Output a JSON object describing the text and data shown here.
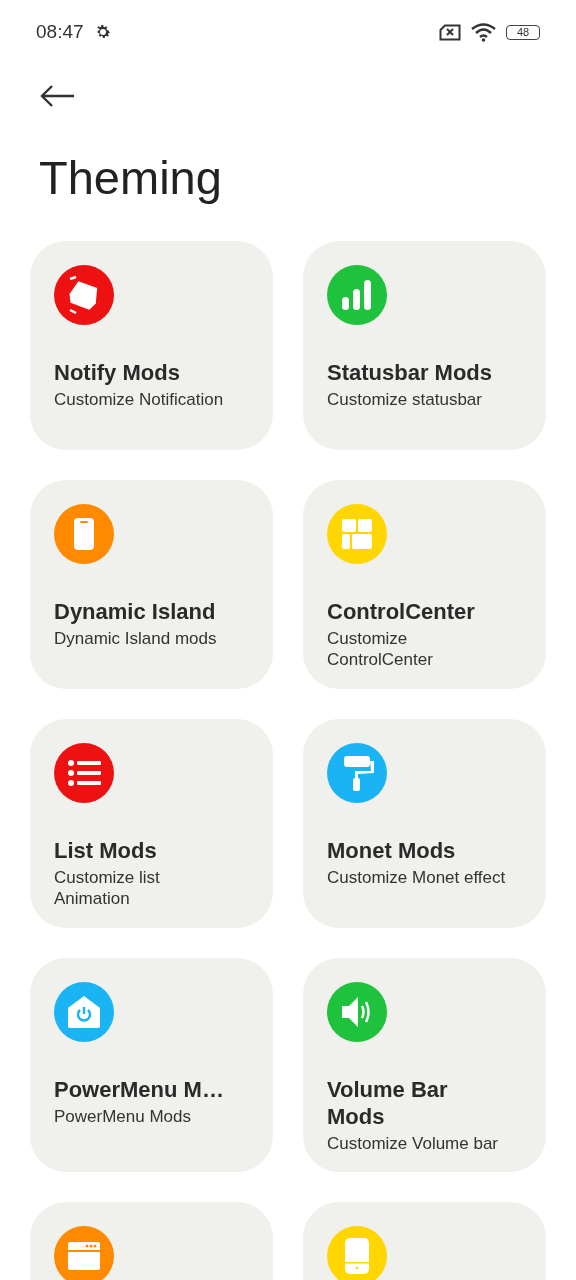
{
  "status_bar": {
    "time": "08:47",
    "battery": "48"
  },
  "title": "Theming",
  "tiles": [
    {
      "color": "#ee1111",
      "title": "Notify Mods",
      "description": "Customize Notification"
    },
    {
      "color": "#1ec23c",
      "title": "Statusbar Mods",
      "description": "Customize statusbar"
    },
    {
      "color": "#ff8a00",
      "title": "Dynamic Island",
      "description": "Dynamic Island mods"
    },
    {
      "color": "#ffd600",
      "title": "ControlCenter",
      "description": "Customize\nControlCenter"
    },
    {
      "color": "#ee1111",
      "title": "List Mods",
      "description": "Customize list\nAnimation"
    },
    {
      "color": "#1ab4f5",
      "title": "Monet Mods",
      "description": "Customize Monet effect"
    },
    {
      "color": "#1ab4f5",
      "title": "PowerMenu M…",
      "description": "PowerMenu Mods"
    },
    {
      "color": "#1ec23c",
      "title": "Volume Bar\nMods",
      "description": "Customize Volume bar"
    },
    {
      "color": "#ff8a00"
    },
    {
      "color": "#ffd600"
    }
  ]
}
